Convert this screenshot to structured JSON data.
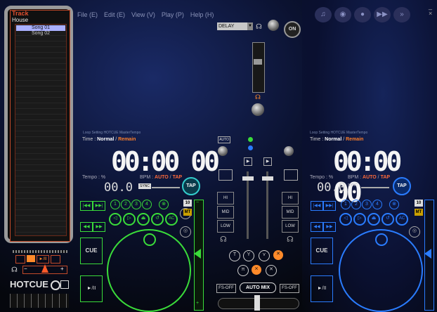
{
  "playlist": {
    "title": "Track",
    "folder": "House",
    "songs": [
      "Song 01",
      "Song 02"
    ]
  },
  "menu": [
    "File (E)",
    "Edit (E)",
    "View (V)",
    "Play (P)",
    "Help (H)"
  ],
  "effects": {
    "selected": "DELAY",
    "on_label": "ON"
  },
  "left_deck": {
    "tabs": "Loop  Setting  HOTCUE  MasterTempo",
    "time_label": "Time :",
    "time_normal": "Normal",
    "time_sep": "/",
    "time_remain": "Remain",
    "time_display": "00:00 00",
    "tempo_label": "Tempo : %",
    "tempo_value": "00.0",
    "bpm_label": "BPM :",
    "bpm_mode": "AUTO",
    "bpm_tap": "TAP",
    "sync_label": "SYNC",
    "tap_button": "TAP",
    "hotcue_numbers": [
      "1",
      "2",
      "3",
      "4"
    ],
    "loop_value": "10",
    "mt_label": "MT",
    "cue_label": "CUE",
    "play_label": "►/II",
    "ac_label": "AC"
  },
  "right_deck": {
    "tabs": "Loop  Setting  HOTCUE  MasterTempo",
    "time_label": "Time :",
    "time_normal": "Normal",
    "time_sep": "/",
    "time_remain": "Remain",
    "time_display": "00:00 00",
    "tempo_label": "Tempo : %",
    "tempo_value": "00.0",
    "bpm_label": "BPM :",
    "bpm_mode": "AUTO",
    "bpm_tap": "TAP",
    "sync_label": "SYNC",
    "tap_button": "TAP",
    "hotcue_numbers": [
      "1",
      "2",
      "3",
      "4"
    ],
    "loop_value": "10",
    "mt_label": "MT",
    "cue_label": "CUE",
    "play_label": "►/II",
    "ac_label": "AC"
  },
  "mixer": {
    "auto_label": "AUTO",
    "eq_labels": [
      "HI",
      "MID",
      "LOW"
    ],
    "auto_mix": "AUTO MIX",
    "fs_off_left": "FS-OFF",
    "fs_off_right": "FS-OFF"
  },
  "bottom_left": {
    "hotcue_label": "HOTCUE"
  },
  "colors": {
    "left_accent": "#3adc3a",
    "right_accent": "#2a7cff",
    "orange": "#ff8a2a",
    "panel_border": "#c24a2a"
  }
}
